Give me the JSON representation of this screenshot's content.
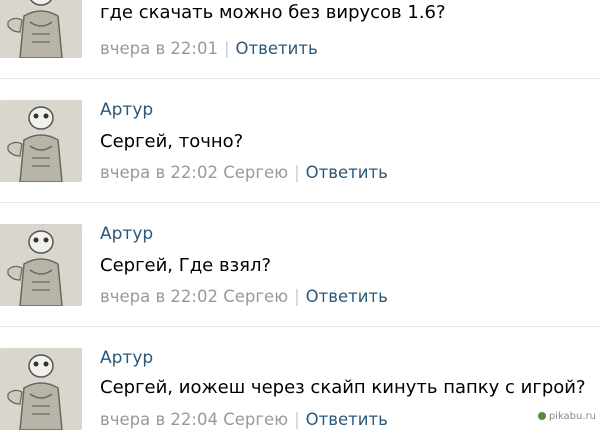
{
  "comments": [
    {
      "author": "",
      "text": "где скачать можно без вирусов 1.6?",
      "time": "вчера в 22:01",
      "to": "",
      "reply": "Ответить",
      "avatar_icon": "cartoon-character-avatar"
    },
    {
      "author": "Артур",
      "text": "Сергей, точно?",
      "time": "вчера в 22:02",
      "to": "Сергею",
      "reply": "Ответить",
      "avatar_icon": "cartoon-character-avatar"
    },
    {
      "author": "Артур",
      "text": "Сергей, Где взял?",
      "time": "вчера в 22:02",
      "to": "Сергею",
      "reply": "Ответить",
      "avatar_icon": "cartoon-character-avatar"
    },
    {
      "author": "Артур",
      "text": "Сергей, иожеш через скайп кинуть папку с игрой?",
      "time": "вчера в 22:04",
      "to": "Сергею",
      "reply": "Ответить",
      "avatar_icon": "cartoon-character-avatar"
    }
  ],
  "separator": "|",
  "watermark": "pikabu.ru",
  "colors": {
    "link": "#2b587a",
    "meta": "#999999",
    "divider": "#e4e7eb"
  }
}
